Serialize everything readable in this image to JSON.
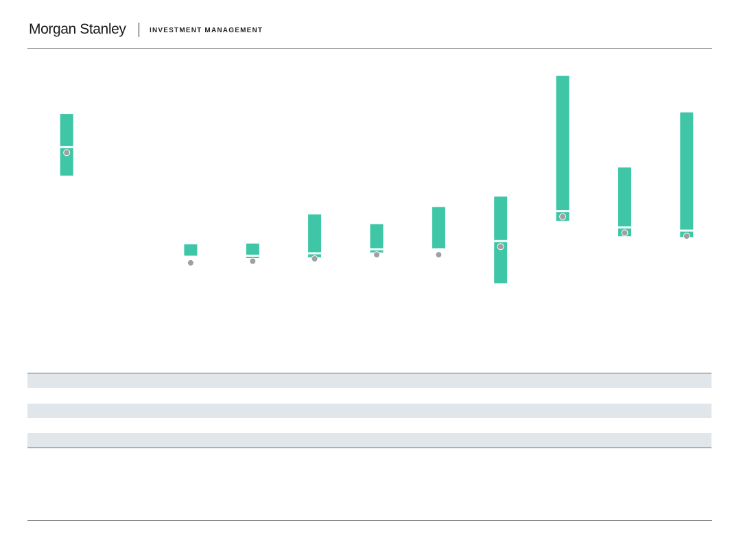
{
  "header": {
    "brand": "Morgan Stanley",
    "division": "INVESTMENT MANAGEMENT"
  },
  "colors": {
    "range_bar": "#3ec6a6",
    "marker_fill": "#a0a0a0",
    "marker_stroke": "#ffffff",
    "table_shade": "#e1e6ea",
    "rule": "#5f6b73"
  },
  "chart_data": {
    "type": "floating-bar",
    "title": "",
    "xlabel": "",
    "ylabel": "",
    "grid": false,
    "legend": "none",
    "ylim": [
      -0.93,
      2.63
    ],
    "categories": [
      "",
      "",
      "",
      "",
      "",
      "",
      "",
      "",
      "",
      "",
      ""
    ],
    "series": [
      {
        "ranges": [
          [
            1.31,
            2.07
          ],
          null,
          [
            0.32,
            0.46
          ],
          [
            0.29,
            0.47
          ],
          [
            0.3,
            0.83
          ],
          [
            0.36,
            0.71
          ],
          [
            0.39,
            0.92
          ],
          [
            -0.02,
            1.05
          ],
          [
            0.75,
            2.54
          ],
          [
            0.56,
            1.41
          ],
          [
            0.55,
            2.09
          ]
        ],
        "markers": [
          1.66,
          null,
          0.3,
          0.32,
          0.35,
          0.4,
          0.4,
          0.5,
          0.87,
          0.67,
          0.63
        ]
      }
    ],
    "table": {
      "rows": 5,
      "shaded_rows": [
        0,
        2,
        4
      ]
    }
  }
}
